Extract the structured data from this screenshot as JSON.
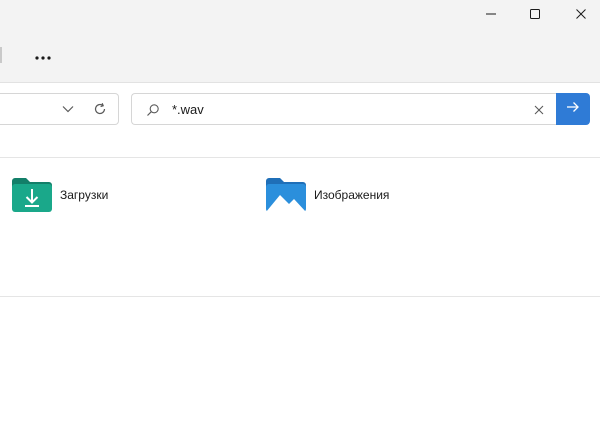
{
  "window": {
    "controls": {
      "minimize_icon": "minimize-icon",
      "maximize_icon": "maximize-icon",
      "close_icon": "close-icon"
    }
  },
  "toolbar": {
    "more_label": "···"
  },
  "address_bar": {
    "dropdown_icon": "chevron-down-icon",
    "refresh_icon": "refresh-icon"
  },
  "search": {
    "value": "*.wav",
    "search_icon": "search-icon",
    "clear_icon": "clear-icon",
    "go_icon": "arrow-right-icon",
    "accent_color": "#2f7bd6"
  },
  "folders": [
    {
      "label": "Загрузки",
      "icon": "downloads-folder-icon",
      "color": "#1aa88a"
    },
    {
      "label": "Изображения",
      "icon": "pictures-folder-icon",
      "color": "#2b8fdc"
    }
  ]
}
